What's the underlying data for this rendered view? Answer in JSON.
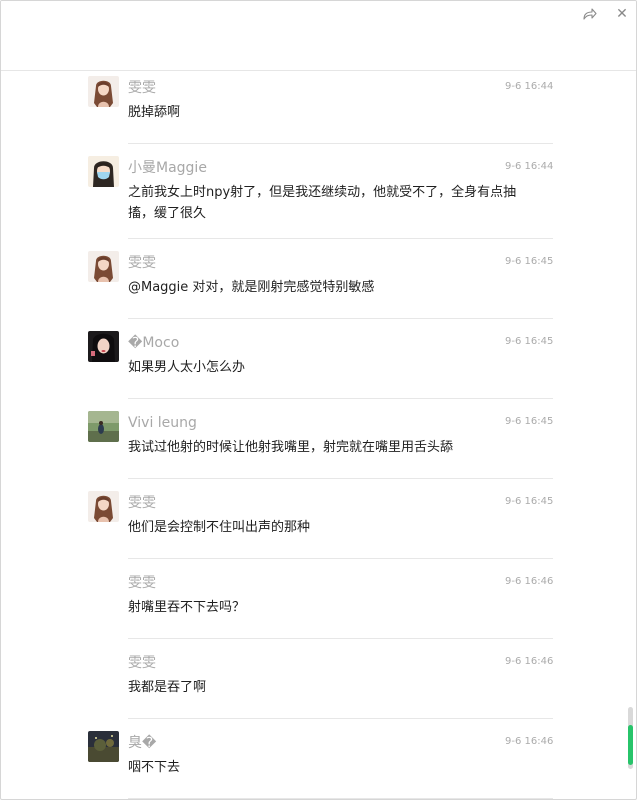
{
  "window": {
    "share_icon": "share-icon",
    "close_icon": "close-icon",
    "close_glyph": "✕"
  },
  "messages": [
    {
      "name": "雯雯",
      "time": "9-6 16:44",
      "text": "脱掉舔啊",
      "avatar": "avatar-girl"
    },
    {
      "name": "小曼Maggie",
      "time": "9-6 16:44",
      "text": "之前我女上时npy射了，但是我还继续动，他就受不了，全身有点抽搐，缓了很久",
      "avatar": "avatar-mask"
    },
    {
      "name": "雯雯",
      "time": "9-6 16:45",
      "text": "@Maggie 对对，就是刚射完感觉特别敏感",
      "avatar": "avatar-girl"
    },
    {
      "name": "�Moco",
      "time": "9-6 16:45",
      "text": "如果男人太小怎么办",
      "avatar": "avatar-dark"
    },
    {
      "name": "Vivi leung",
      "time": "9-6 16:45",
      "text": "我试过他射的时候让他射我嘴里，射完就在嘴里用舌头舔",
      "avatar": "avatar-outdoor"
    },
    {
      "name": "雯雯",
      "time": "9-6 16:45",
      "text": "他们是会控制不住叫出声的那种",
      "avatar": "avatar-girl"
    },
    {
      "name": "雯雯",
      "time": "9-6 16:46",
      "text": "射嘴里吞不下去吗？",
      "avatar": ""
    },
    {
      "name": "雯雯",
      "time": "9-6 16:46",
      "text": "我都是吞了啊",
      "avatar": ""
    },
    {
      "name": "臭�",
      "time": "9-6 16:46",
      "text": "咽不下去",
      "avatar": "avatar-night"
    }
  ],
  "colors": {
    "name": "#a8a8a8",
    "time": "#ababab",
    "text": "#1f1f1f",
    "divider": "#e7e7e7",
    "scroll_accent": "#27c46a"
  }
}
